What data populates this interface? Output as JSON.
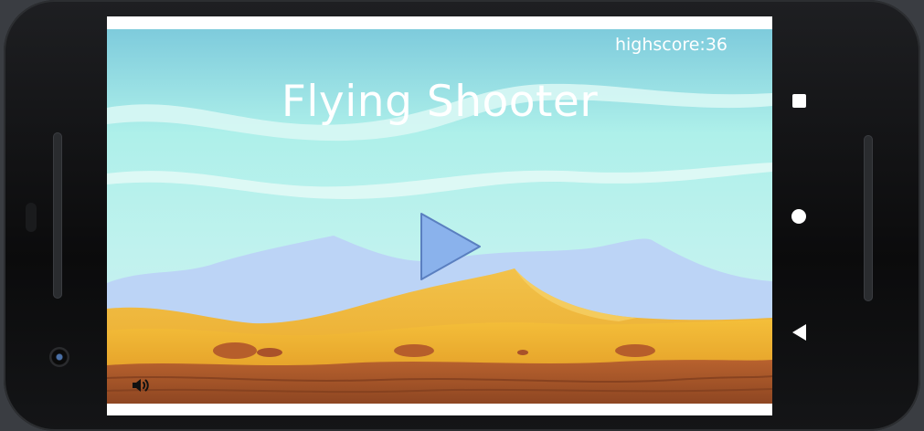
{
  "game": {
    "title": "Flying Shooter",
    "highscore": "highscore:36"
  },
  "icons": {
    "play": "play-icon",
    "sound": "speaker-volume-icon",
    "nav_overview": "square-icon",
    "nav_home": "circle-icon",
    "nav_back": "triangle-back-icon"
  },
  "colors": {
    "sky_top": "#7ecbdc",
    "sky_mid": "#aef0ea",
    "mountains": "#bcd4f6",
    "sand": "#f0b431",
    "ground": "#a85a2c",
    "play_button": "#8ab2ec"
  }
}
